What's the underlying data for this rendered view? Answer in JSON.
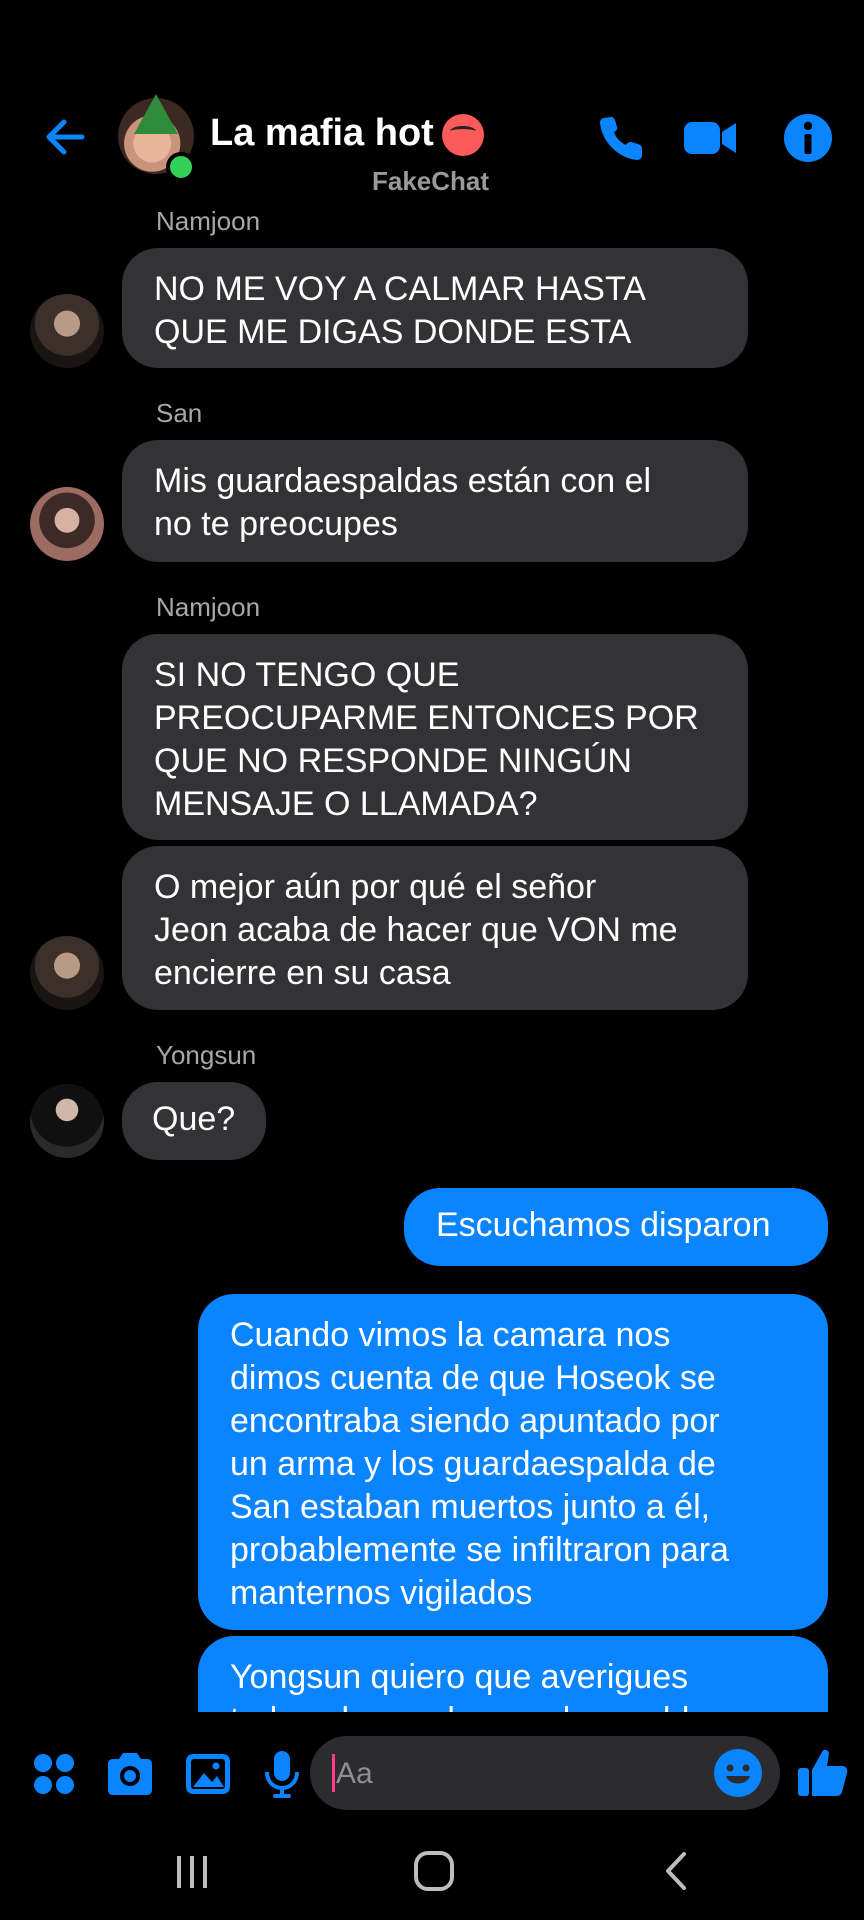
{
  "header": {
    "title": "La mafia hot",
    "watermark": "FakeChat",
    "icons": [
      "back-arrow-icon",
      "phone-icon",
      "video-camera-icon",
      "info-icon"
    ],
    "accent_color": "#0a84ff"
  },
  "messages": [
    {
      "type": "incoming",
      "sender": "Namjoon",
      "text": "NO ME VOY A CALMAR HASTA\nQUE ME DIGAS DONDE ESTA"
    },
    {
      "type": "incoming",
      "sender": "San",
      "text": "Mis guardaespaldas están con el\nno te preocupes"
    },
    {
      "type": "incoming",
      "sender": "Namjoon",
      "text": "SI NO TENGO QUE\nPREOCUPARME ENTONCES POR\nQUE NO RESPONDE NINGÚN\nMENSAJE O LLAMADA?"
    },
    {
      "type": "incoming",
      "sender": "",
      "text": "O mejor aún por qué el señor\nJeon acaba de hacer que VON me\nencierre en su casa"
    },
    {
      "type": "incoming",
      "sender": "Yongsun",
      "text": "Que?"
    },
    {
      "type": "outgoing",
      "text": "Escuchamos disparon"
    },
    {
      "type": "outgoing",
      "text": "Cuando vimos la camara nos\ndimos cuenta de que Hoseok se\nencontraba siendo apuntado por\nun arma y los guardaespalda de\nSan estaban muertos junto a él,\nprobablemente se  infiltraron para\nmanternos vigilados"
    },
    {
      "type": "outgoing",
      "text": "Yongsun quiero que averigues\ntodo sobre cada guardaespaldas"
    }
  ],
  "composer": {
    "placeholder": "Aa",
    "icons": [
      "apps-grid-icon",
      "camera-icon",
      "gallery-icon",
      "microphone-icon",
      "emoji-icon",
      "thumbs-up-icon"
    ]
  },
  "system_nav": {
    "icons": [
      "recent-apps-icon",
      "home-icon",
      "back-icon"
    ]
  },
  "colors": {
    "background": "#000000",
    "incoming_bubble": "#333335",
    "outgoing_bubble": "#0a84ff",
    "online": "#31d158"
  }
}
